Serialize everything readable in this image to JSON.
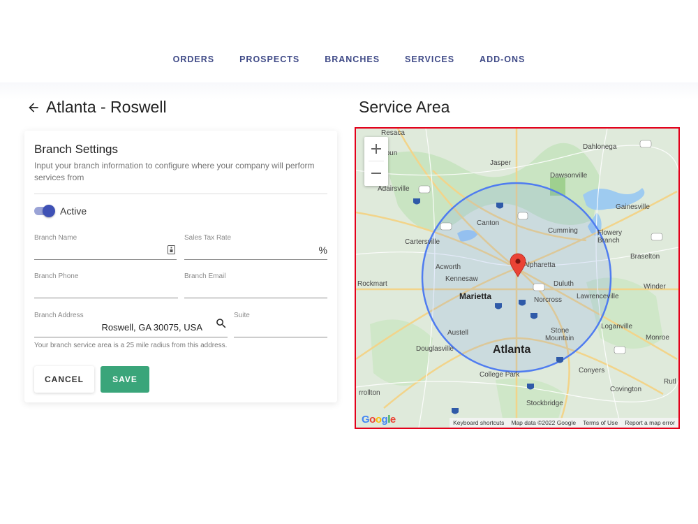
{
  "nav": {
    "items": [
      "ORDERS",
      "PROSPECTS",
      "BRANCHES",
      "SERVICES",
      "ADD-ONS"
    ]
  },
  "branch": {
    "title": "Atlanta - Roswell"
  },
  "settings": {
    "title": "Branch Settings",
    "description": "Input your branch information to configure where your company will perform services from",
    "active_label": "Active",
    "active": true,
    "fields": {
      "name_label": "Branch Name",
      "name_value": "",
      "tax_label": "Sales Tax Rate",
      "tax_value": "",
      "tax_suffix": "%",
      "phone_label": "Branch Phone",
      "phone_value": "",
      "email_label": "Branch Email",
      "email_value": "",
      "address_label": "Branch Address",
      "address_value": "Roswell, GA 30075, USA",
      "suite_label": "Suite",
      "suite_value": ""
    },
    "helper": "Your branch service area is a 25 mile radius from this address.",
    "cancel_label": "CANCEL",
    "save_label": "SAVE"
  },
  "map": {
    "title": "Service Area",
    "zoom_in": "+",
    "zoom_out": "−",
    "footer": {
      "shortcuts": "Keyboard shortcuts",
      "data": "Map data ©2022 Google",
      "terms": "Terms of Use",
      "report": "Report a map error"
    },
    "places": {
      "resaca": "Resaca",
      "calhoun": "Calhoun",
      "jasper": "Jasper",
      "dahlonega": "Dahlonega",
      "dawsonville": "Dawsonville",
      "adairsville": "Adairsville",
      "gainesville": "Gainesville",
      "canton": "Canton",
      "cumming": "Cumming",
      "flowery": "Flowery",
      "branch": "Branch",
      "cartersville": "Cartersville",
      "braselton": "Braselton",
      "acworth": "Acworth",
      "alpharetta": "Alpharetta",
      "kennesaw": "Kennesaw",
      "rockmart": "Rockmart",
      "duluth": "Duluth",
      "winder": "Winder",
      "marietta": "Marietta",
      "lawrenceville": "Lawrenceville",
      "norcross": "Norcross",
      "austell": "Austell",
      "stone": "Stone",
      "mountain": "Mountain",
      "loganville": "Loganville",
      "monroe": "Monroe",
      "douglasville": "Douglasville",
      "atlanta": "Atlanta",
      "conyers": "Conyers",
      "college_park": "College Park",
      "covington": "Covington",
      "carrollton": "rrollton",
      "stockbridge": "Stockbridge",
      "rut": "Rutl"
    },
    "colors": {
      "circle": "#4f7cf0",
      "pin": "#ea4335",
      "water": "#9ecbf0",
      "park": "#c6e3bf"
    }
  }
}
